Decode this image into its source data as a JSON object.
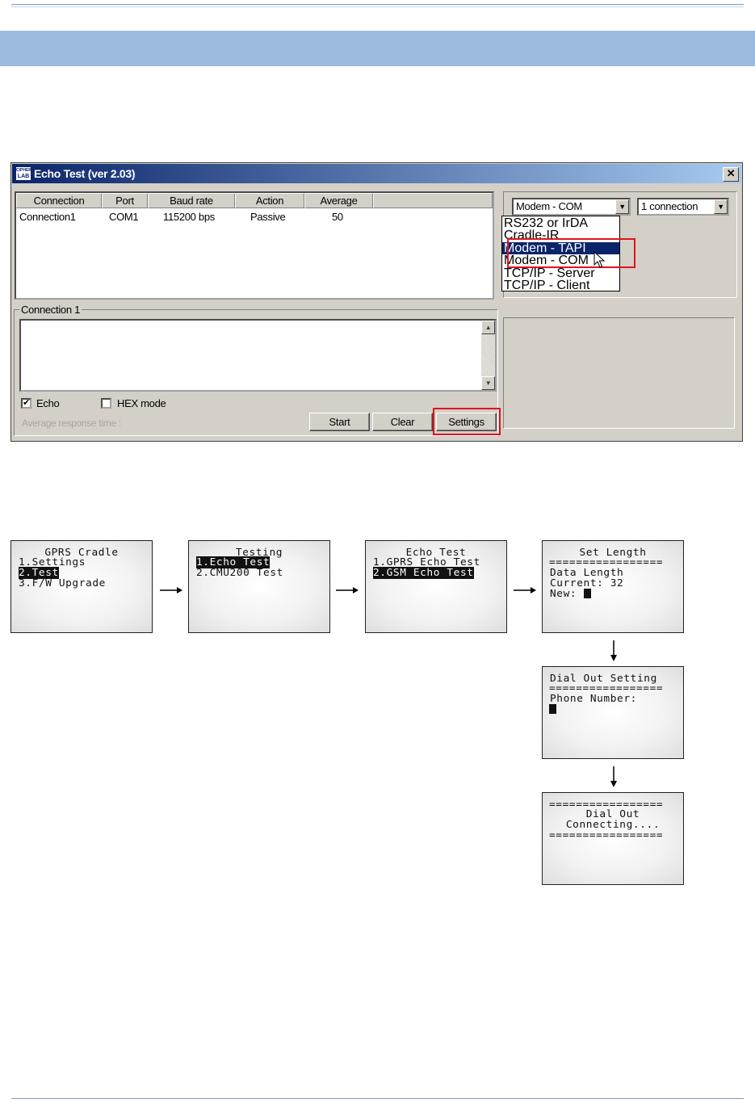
{
  "window": {
    "title": "Echo Test (ver 2.03)",
    "icon_text_top": "CIPHER",
    "icon_text_bottom": "LAB",
    "close_glyph": "✕"
  },
  "connections_table": {
    "headers": [
      "Connection",
      "Port",
      "Baud rate",
      "Action",
      "Average"
    ],
    "rows": [
      [
        "Connection1",
        "COM1",
        "115200 bps",
        "Passive",
        "50"
      ]
    ]
  },
  "connection_type": {
    "selected": "Modem - COM",
    "options": [
      "RS232 or IrDA",
      "Cradle-IR",
      "Modem - TAPI",
      "Modem - COM",
      "TCP/IP - Server",
      "TCP/IP - Client"
    ],
    "highlighted": "Modem - TAPI"
  },
  "connection_count": {
    "selected": "1 connection"
  },
  "connection_panel": {
    "label": "Connection 1",
    "echo_label": "Echo",
    "echo_checked": true,
    "hex_label": "HEX mode",
    "hex_checked": false,
    "avg_response_label": "Average response time :",
    "start_label": "Start",
    "clear_label": "Clear",
    "settings_label": "Settings"
  },
  "screens": {
    "gprs_cradle": {
      "title": "GPRS Cradle",
      "items": [
        "1.Settings",
        "2.Test",
        "3.F/W Upgrade"
      ],
      "selected": 1
    },
    "testing": {
      "title": "Testing",
      "items": [
        "1.Echo Test",
        "2.CMU200 Test"
      ],
      "selected": 0
    },
    "echo_test": {
      "title": "Echo Test",
      "items": [
        "1.GPRS Echo Test",
        "2.GSM Echo Test"
      ],
      "selected": 1
    },
    "set_length": {
      "title": "Set Length",
      "divider": "=================",
      "line1": "Data Length",
      "line2": "Current: 32",
      "line3": "New:"
    },
    "dial_out_setting": {
      "title": "Dial Out Setting",
      "divider": "=================",
      "line1": "Phone Number:"
    },
    "dial_out": {
      "divider": "=================",
      "line1": "Dial Out",
      "line2": "Connecting....",
      "divider2": "================="
    }
  },
  "colors": {
    "titlebar": "#0a246a",
    "highlight": "#e0141e",
    "header_band": "#9dbbdc"
  }
}
